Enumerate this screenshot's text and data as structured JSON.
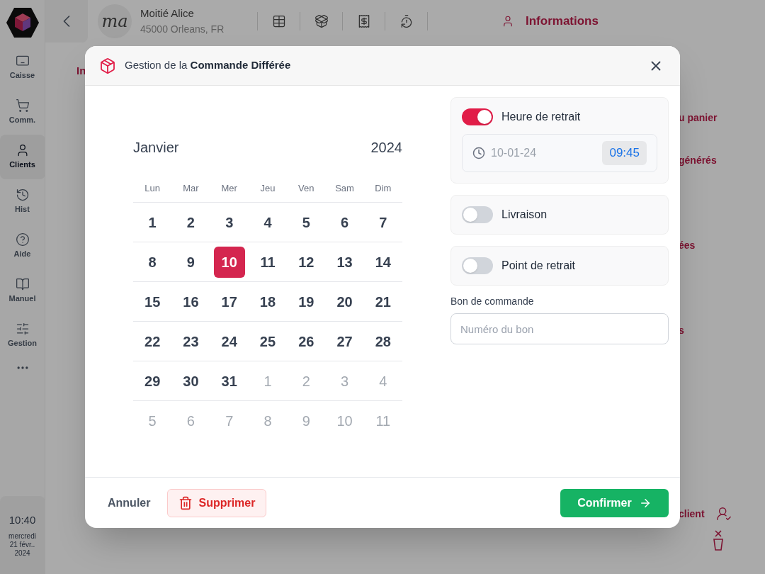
{
  "sidebar": {
    "items": [
      {
        "label": "Caisse",
        "selected": false
      },
      {
        "label": "Comm.",
        "selected": false
      },
      {
        "label": "Clients",
        "selected": true
      },
      {
        "label": "Hist",
        "selected": false
      },
      {
        "label": "Aide",
        "selected": false
      },
      {
        "label": "Manuel",
        "selected": false
      },
      {
        "label": "Gestion",
        "selected": false
      }
    ],
    "clock": {
      "time": "10:40",
      "day": "mercredi",
      "date": "21 févr..",
      "year": "2024"
    }
  },
  "topbar": {
    "client": {
      "initials": "ma",
      "name": "Moitié Alice",
      "address": "45000 Orleans, FR"
    },
    "tab": {
      "label": "Informations"
    }
  },
  "background": {
    "left_fragment": "In",
    "right_fragments": [
      "u panier",
      "générés",
      "ées",
      "s"
    ],
    "client_action": "client"
  },
  "dialog": {
    "title": "Gestion de la **Commande Différée**",
    "calendar": {
      "month": "Janvier",
      "year": "2024",
      "weekdays": [
        "Lun",
        "Mar",
        "Mer",
        "Jeu",
        "Ven",
        "Sam",
        "Dim"
      ],
      "days": [
        {
          "label": "1",
          "outside": false,
          "selected": false
        },
        {
          "label": "2",
          "outside": false,
          "selected": false
        },
        {
          "label": "3",
          "outside": false,
          "selected": false
        },
        {
          "label": "4",
          "outside": false,
          "selected": false
        },
        {
          "label": "5",
          "outside": false,
          "selected": false
        },
        {
          "label": "6",
          "outside": false,
          "selected": false
        },
        {
          "label": "7",
          "outside": false,
          "selected": false
        },
        {
          "label": "8",
          "outside": false,
          "selected": false
        },
        {
          "label": "9",
          "outside": false,
          "selected": false
        },
        {
          "label": "10",
          "outside": false,
          "selected": true
        },
        {
          "label": "11",
          "outside": false,
          "selected": false
        },
        {
          "label": "12",
          "outside": false,
          "selected": false
        },
        {
          "label": "13",
          "outside": false,
          "selected": false
        },
        {
          "label": "14",
          "outside": false,
          "selected": false
        },
        {
          "label": "15",
          "outside": false,
          "selected": false
        },
        {
          "label": "16",
          "outside": false,
          "selected": false
        },
        {
          "label": "17",
          "outside": false,
          "selected": false
        },
        {
          "label": "18",
          "outside": false,
          "selected": false
        },
        {
          "label": "19",
          "outside": false,
          "selected": false
        },
        {
          "label": "20",
          "outside": false,
          "selected": false
        },
        {
          "label": "21",
          "outside": false,
          "selected": false
        },
        {
          "label": "22",
          "outside": false,
          "selected": false
        },
        {
          "label": "23",
          "outside": false,
          "selected": false
        },
        {
          "label": "24",
          "outside": false,
          "selected": false
        },
        {
          "label": "25",
          "outside": false,
          "selected": false
        },
        {
          "label": "26",
          "outside": false,
          "selected": false
        },
        {
          "label": "27",
          "outside": false,
          "selected": false
        },
        {
          "label": "28",
          "outside": false,
          "selected": false
        },
        {
          "label": "29",
          "outside": false,
          "selected": false
        },
        {
          "label": "30",
          "outside": false,
          "selected": false
        },
        {
          "label": "31",
          "outside": false,
          "selected": false
        },
        {
          "label": "1",
          "outside": true,
          "selected": false
        },
        {
          "label": "2",
          "outside": true,
          "selected": false
        },
        {
          "label": "3",
          "outside": true,
          "selected": false
        },
        {
          "label": "4",
          "outside": true,
          "selected": false
        },
        {
          "label": "5",
          "outside": true,
          "selected": false
        },
        {
          "label": "6",
          "outside": true,
          "selected": false
        },
        {
          "label": "7",
          "outside": true,
          "selected": false
        },
        {
          "label": "8",
          "outside": true,
          "selected": false
        },
        {
          "label": "9",
          "outside": true,
          "selected": false
        },
        {
          "label": "10",
          "outside": true,
          "selected": false
        },
        {
          "label": "11",
          "outside": true,
          "selected": false
        }
      ]
    },
    "options": [
      {
        "label": "Heure de retrait",
        "on": true,
        "date": "10-01-24",
        "time": "09:45"
      },
      {
        "label": "Livraison",
        "on": false
      },
      {
        "label": "Point de retrait",
        "on": false
      }
    ],
    "order_field": {
      "label": "Bon de commande",
      "placeholder": "Numéro du bon"
    },
    "buttons": {
      "cancel": "Annuler",
      "delete": "Supprimer",
      "confirm": "Confirmer"
    }
  }
}
